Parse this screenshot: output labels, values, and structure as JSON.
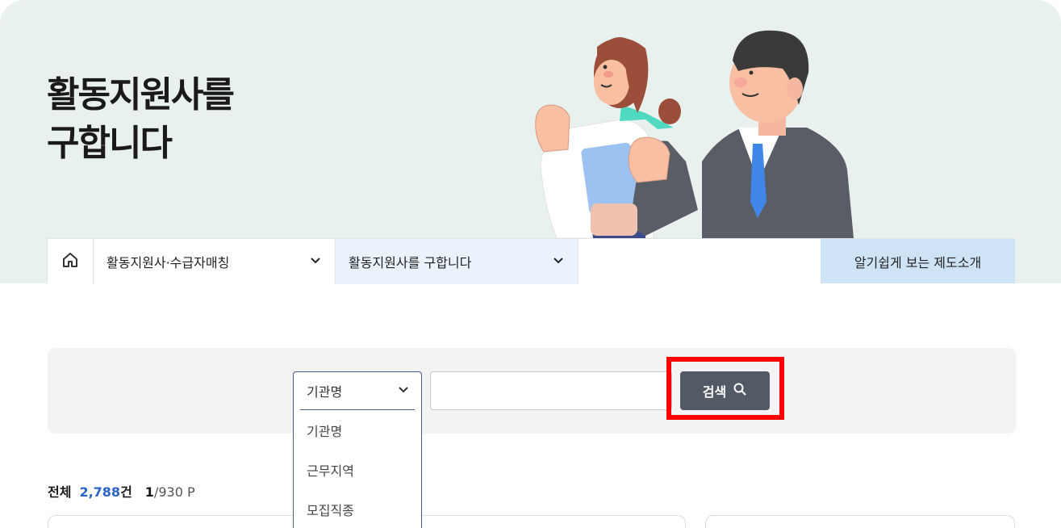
{
  "hero": {
    "title_line1": "활동지원사를",
    "title_line2": "구합니다"
  },
  "nav": {
    "home_icon": "home-icon",
    "menu1_label": "활동지원사·수급자매칭",
    "menu2_label": "활동지원사를 구합니다",
    "intro_label": "알기쉽게 보는 제도소개"
  },
  "search": {
    "select_value": "기관명",
    "options": [
      "기관명",
      "근무지역",
      "모집직종"
    ],
    "input_value": "",
    "button_label": "검색",
    "button_icon": "search-icon"
  },
  "results": {
    "total_label": "전체",
    "total_count": "2,788",
    "total_unit": "건",
    "page_current": "1",
    "page_rest": "/930 P"
  },
  "colors": {
    "hero_bg": "#e9f1ef",
    "accent_blue": "#2a63c9",
    "button_bg": "#525a66",
    "highlight": "#ff0000",
    "intro_bg": "#cfe3f7"
  }
}
